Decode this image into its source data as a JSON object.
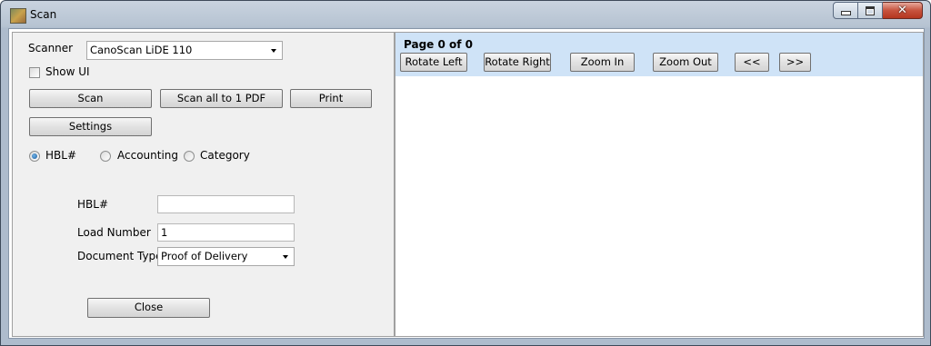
{
  "window": {
    "title": "Scan",
    "icon": "scanner-app-icon"
  },
  "scanner": {
    "label": "Scanner",
    "selected": "CanoScan LiDE 110"
  },
  "show_ui": {
    "label": "Show UI",
    "checked": false
  },
  "buttons": {
    "scan": "Scan",
    "scan_all": "Scan all to 1 PDF",
    "print": "Print",
    "settings": "Settings",
    "close": "Close"
  },
  "radios": [
    {
      "label": "HBL#",
      "checked": true
    },
    {
      "label": "Accounting",
      "checked": false
    },
    {
      "label": "Category",
      "checked": false
    }
  ],
  "fields": {
    "hbl_label": "HBL#",
    "hbl_value": "",
    "load_label": "Load Number",
    "load_value": "1",
    "doctype_label": "Document Type",
    "doctype_value": "Proof of Delivery"
  },
  "viewer": {
    "page_text": "Page 0 of 0",
    "rotate_left": "Rotate Left",
    "rotate_right": "Rotate Right",
    "zoom_in": "Zoom In",
    "zoom_out": "Zoom Out",
    "prev": "<<",
    "next": ">>",
    "bar_color": "#cfe3f7"
  }
}
